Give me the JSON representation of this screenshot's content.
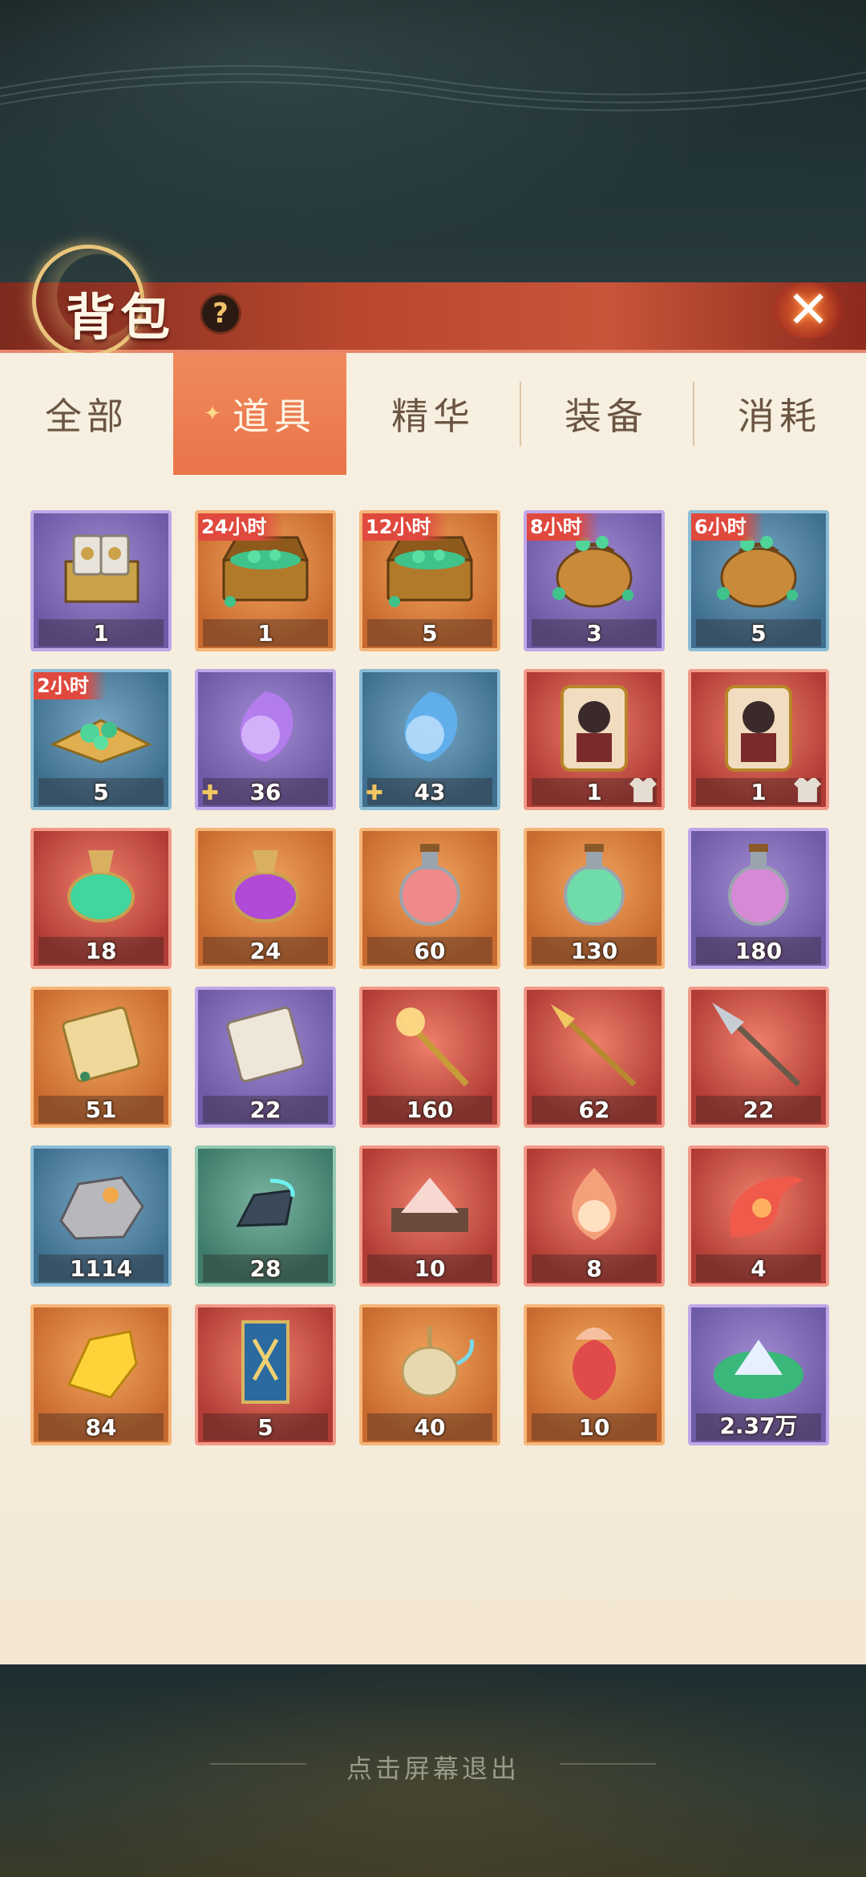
{
  "header": {
    "title": "背包",
    "help_label": "?",
    "close_label": "✕"
  },
  "tabs": [
    {
      "label": "全部",
      "active": false
    },
    {
      "label": "道具",
      "active": true
    },
    {
      "label": "精华",
      "active": false
    },
    {
      "label": "装备",
      "active": false
    },
    {
      "label": "消耗",
      "active": false
    }
  ],
  "items": [
    {
      "icon": "silver-card-box-icon",
      "rarity": "purple",
      "count": "1",
      "timer": ""
    },
    {
      "icon": "gem-treasure-chest-icon",
      "rarity": "orange",
      "count": "1",
      "timer": "24小时"
    },
    {
      "icon": "gem-treasure-chest-icon",
      "rarity": "orange",
      "count": "5",
      "timer": "12小时"
    },
    {
      "icon": "gem-pouch-icon",
      "rarity": "purple",
      "count": "3",
      "timer": "8小时"
    },
    {
      "icon": "gem-pouch-icon",
      "rarity": "blue",
      "count": "5",
      "timer": "6小时"
    },
    {
      "icon": "gem-pile-icon",
      "rarity": "blue",
      "count": "5",
      "timer": "2小时"
    },
    {
      "icon": "purple-soul-flame-icon",
      "rarity": "purple",
      "count": "36",
      "timer": "",
      "fragment": true
    },
    {
      "icon": "blue-soul-flame-icon",
      "rarity": "blue",
      "count": "43",
      "timer": "",
      "fragment": true
    },
    {
      "icon": "character-skin-card-icon",
      "rarity": "red",
      "count": "1",
      "timer": "",
      "skin": true
    },
    {
      "icon": "character-skin-card-icon",
      "rarity": "red",
      "count": "1",
      "timer": "",
      "skin": true
    },
    {
      "icon": "green-elixir-vase-icon",
      "rarity": "red",
      "count": "18",
      "timer": ""
    },
    {
      "icon": "purple-elixir-vase-icon",
      "rarity": "orange",
      "count": "24",
      "timer": ""
    },
    {
      "icon": "red-potion-flask-icon",
      "rarity": "orange",
      "count": "60",
      "timer": ""
    },
    {
      "icon": "green-potion-flask-icon",
      "rarity": "orange",
      "count": "130",
      "timer": ""
    },
    {
      "icon": "purple-potion-flask-icon",
      "rarity": "purple",
      "count": "180",
      "timer": ""
    },
    {
      "icon": "golden-scroll-icon",
      "rarity": "orange",
      "count": "51",
      "timer": ""
    },
    {
      "icon": "silver-scroll-icon",
      "rarity": "purple",
      "count": "22",
      "timer": ""
    },
    {
      "icon": "golden-staff-icon",
      "rarity": "red",
      "count": "160",
      "timer": ""
    },
    {
      "icon": "golden-spear-icon",
      "rarity": "red",
      "count": "62",
      "timer": ""
    },
    {
      "icon": "silver-spearhead-icon",
      "rarity": "red",
      "count": "22",
      "timer": ""
    },
    {
      "icon": "ore-stone-icon",
      "rarity": "blue",
      "count": "1114",
      "timer": ""
    },
    {
      "icon": "enhance-stone-icon",
      "rarity": "green",
      "count": "28",
      "timer": ""
    },
    {
      "icon": "salt-crystal-icon",
      "rarity": "red",
      "count": "10",
      "timer": ""
    },
    {
      "icon": "fire-drop-icon",
      "rarity": "red",
      "count": "8",
      "timer": ""
    },
    {
      "icon": "phoenix-feather-icon",
      "rarity": "red",
      "count": "4",
      "timer": ""
    },
    {
      "icon": "gold-ore-icon",
      "rarity": "orange",
      "count": "84",
      "timer": ""
    },
    {
      "icon": "sword-banner-icon",
      "rarity": "red",
      "count": "5",
      "timer": ""
    },
    {
      "icon": "magic-ewer-icon",
      "rarity": "orange",
      "count": "40",
      "timer": ""
    },
    {
      "icon": "red-flower-bud-icon",
      "rarity": "orange",
      "count": "10",
      "timer": ""
    },
    {
      "icon": "crystal-leaf-icon",
      "rarity": "purple",
      "count": "2.37万",
      "timer": ""
    }
  ],
  "footer": {
    "exit_hint": "点击屏幕退出"
  }
}
